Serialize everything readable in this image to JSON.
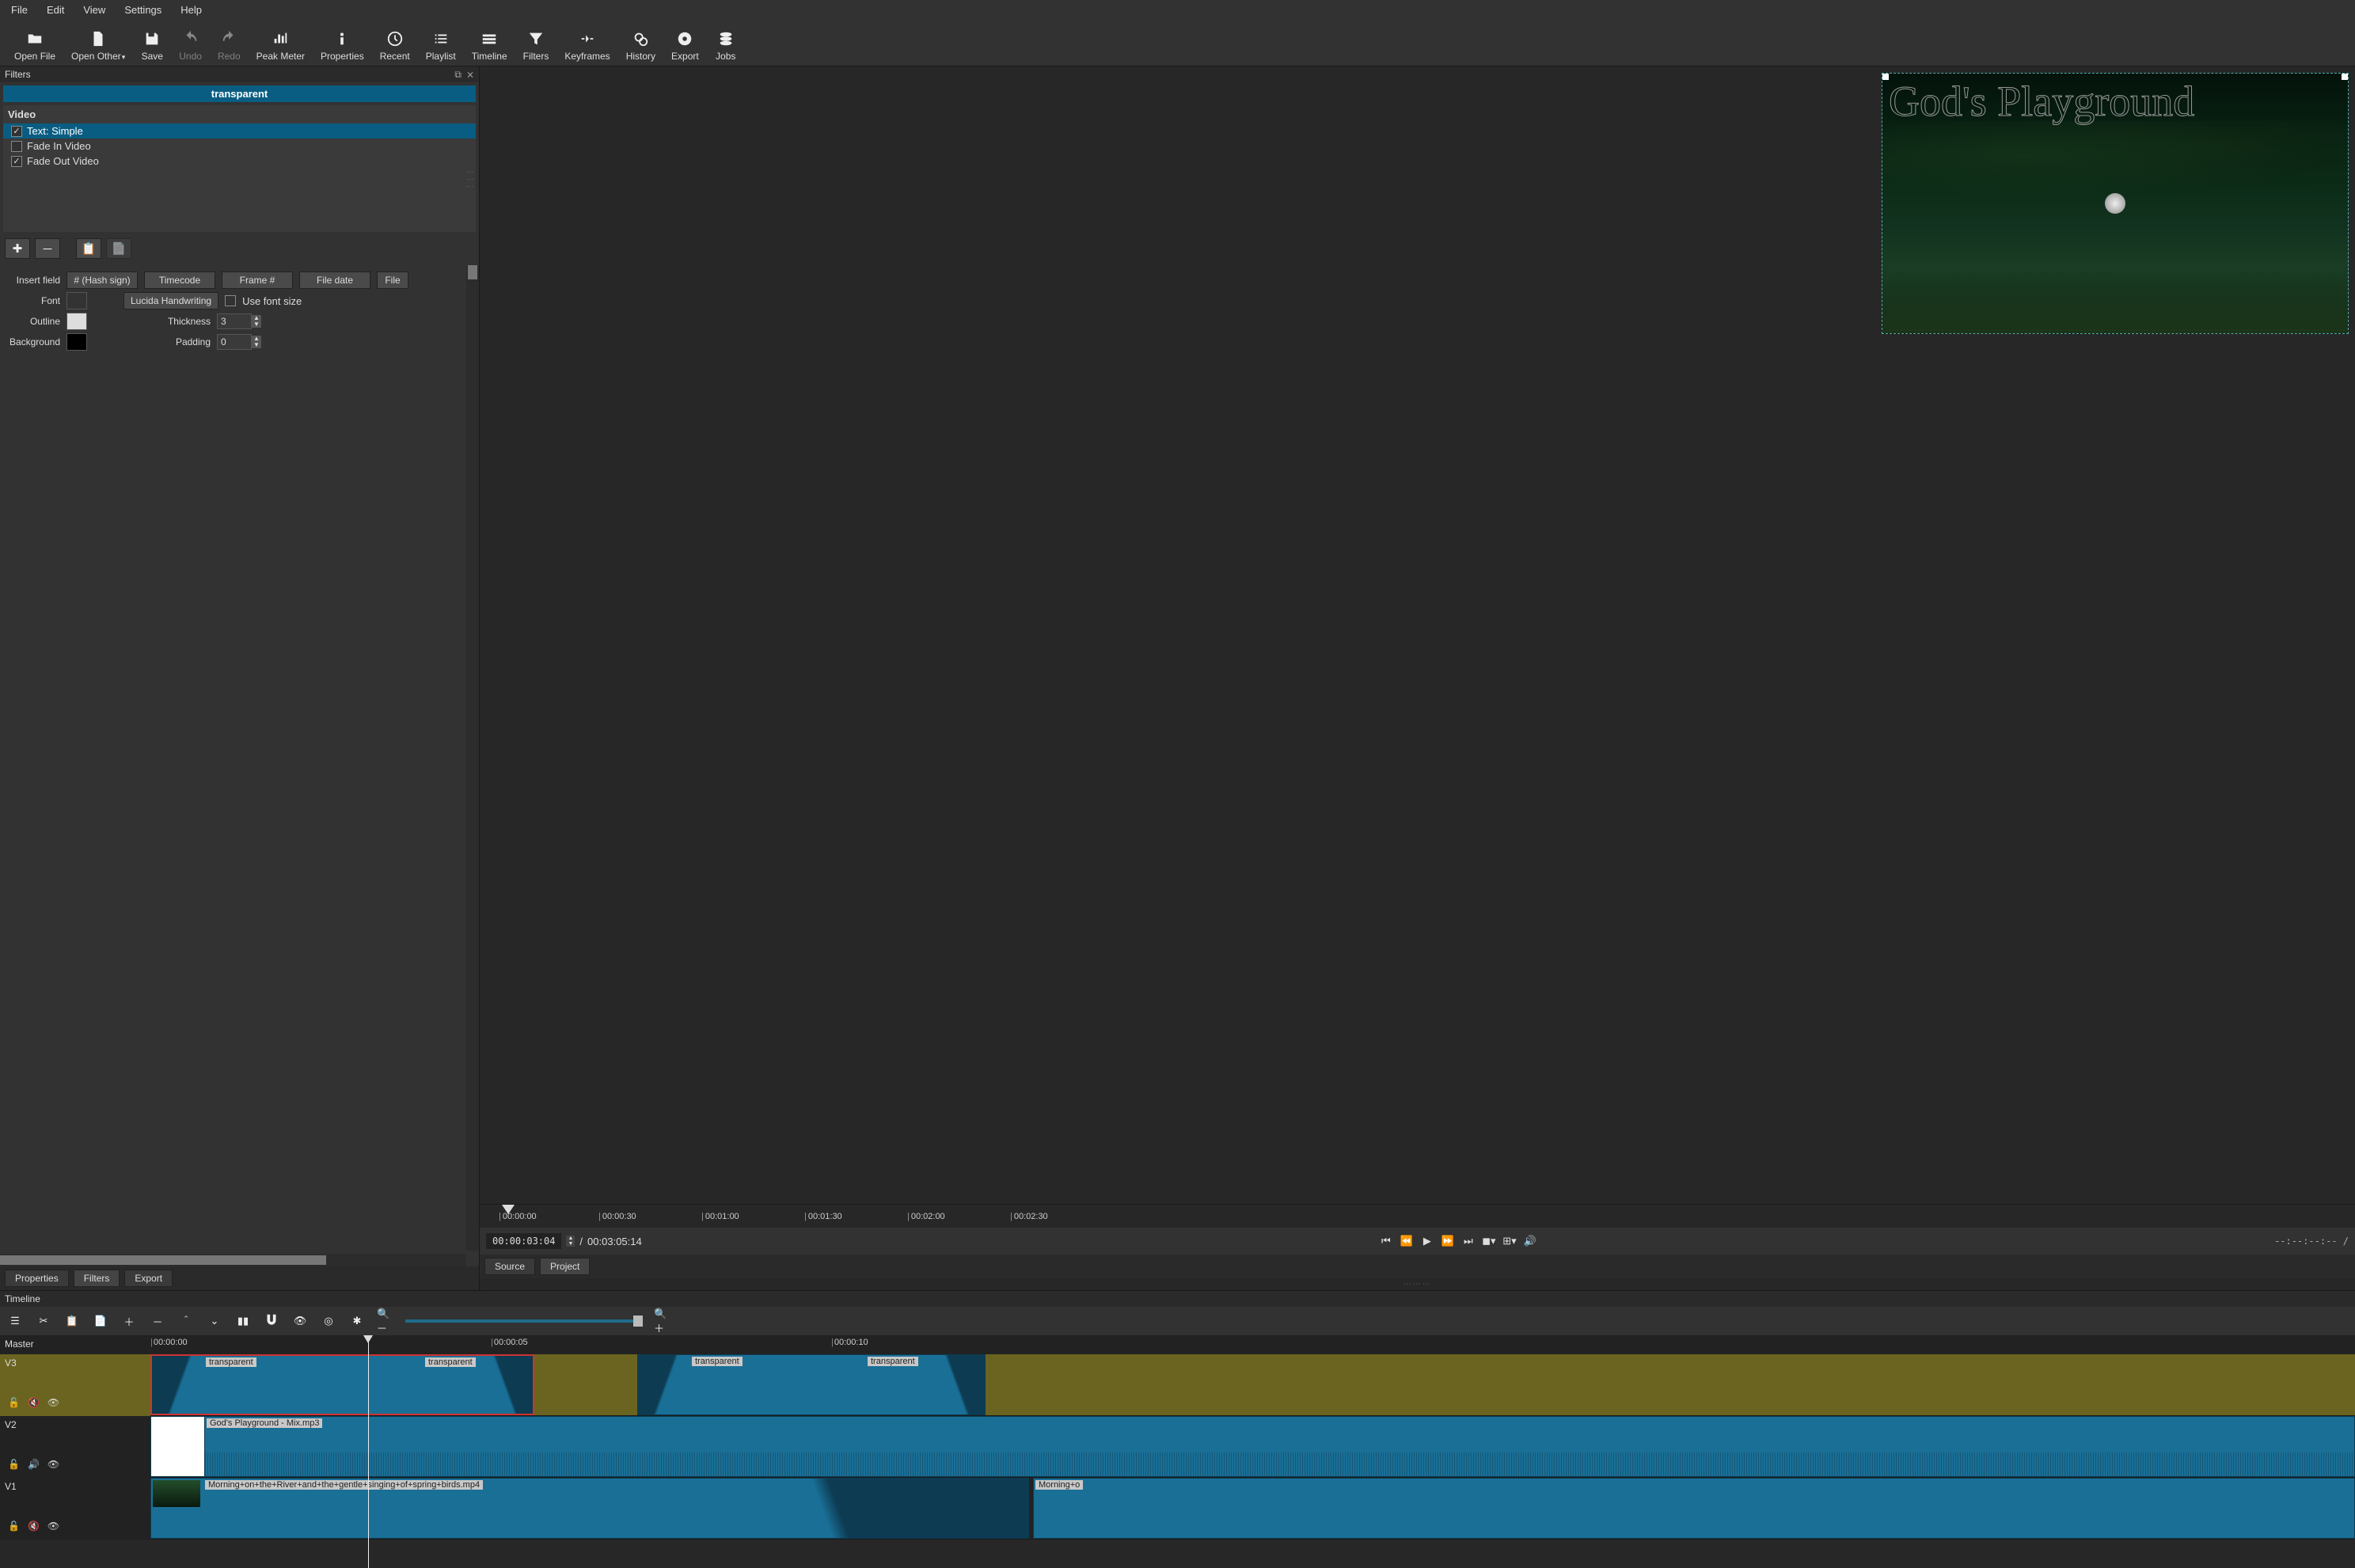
{
  "menubar": [
    "File",
    "Edit",
    "View",
    "Settings",
    "Help"
  ],
  "toolbar": [
    {
      "id": "open-file",
      "label": "Open File",
      "icon": "folder"
    },
    {
      "id": "open-other",
      "label": "Open Other",
      "icon": "file",
      "caret": true
    },
    {
      "id": "save",
      "label": "Save",
      "icon": "save"
    },
    {
      "id": "undo",
      "label": "Undo",
      "icon": "undo",
      "disabled": true
    },
    {
      "id": "redo",
      "label": "Redo",
      "icon": "redo",
      "disabled": true
    },
    {
      "id": "peak-meter",
      "label": "Peak Meter",
      "icon": "meter"
    },
    {
      "id": "properties",
      "label": "Properties",
      "icon": "info"
    },
    {
      "id": "recent",
      "label": "Recent",
      "icon": "clock"
    },
    {
      "id": "playlist",
      "label": "Playlist",
      "icon": "list"
    },
    {
      "id": "timeline",
      "label": "Timeline",
      "icon": "timeline"
    },
    {
      "id": "filters",
      "label": "Filters",
      "icon": "funnel"
    },
    {
      "id": "keyframes",
      "label": "Keyframes",
      "icon": "keyframes"
    },
    {
      "id": "history",
      "label": "History",
      "icon": "history"
    },
    {
      "id": "export",
      "label": "Export",
      "icon": "disc"
    },
    {
      "id": "jobs",
      "label": "Jobs",
      "icon": "stack"
    }
  ],
  "filters_panel": {
    "title": "Filters",
    "clip_name": "transparent",
    "group": "Video",
    "items": [
      {
        "label": "Text: Simple",
        "checked": true,
        "selected": true
      },
      {
        "label": "Fade In Video",
        "checked": false,
        "selected": false
      },
      {
        "label": "Fade Out Video",
        "checked": true,
        "selected": false
      }
    ]
  },
  "text_filter": {
    "insert_field_label": "Insert field",
    "buttons": [
      "# (Hash sign)",
      "Timecode",
      "Frame #",
      "File date",
      "File"
    ],
    "font_label": "Font",
    "font_name": "Lucida Handwriting",
    "use_font_size_label": "Use font size",
    "outline_label": "Outline",
    "thickness_label": "Thickness",
    "thickness_value": "3",
    "background_label": "Background",
    "padding_label": "Padding",
    "padding_value": "0"
  },
  "left_tabs": [
    "Properties",
    "Filters",
    "Export"
  ],
  "left_tabs_active": 1,
  "preview": {
    "overlay_text": "God's Playground",
    "ruler": [
      "00:00:00",
      "00:00:30",
      "00:01:00",
      "00:01:30",
      "00:02:00",
      "00:02:30"
    ],
    "current_tc": "00:00:03:04",
    "total_tc": "00:03:05:14",
    "inout": "--:--:--:-- /"
  },
  "right_tabs": [
    "Source",
    "Project"
  ],
  "right_tabs_active": 1,
  "timeline": {
    "title": "Timeline",
    "master": "Master",
    "ruler": [
      "00:00:00",
      "00:00:05",
      "00:00:10"
    ],
    "track3": {
      "name": "V3",
      "clip1": "transparent",
      "clip2": "transparent",
      "clip3": "transparent",
      "clip4": "transparent"
    },
    "track2": {
      "name": "V2",
      "clip": "God's Playground - Mix.mp3"
    },
    "track1": {
      "name": "V1",
      "clip": "Morning+on+the+River+and+the+gentle+singing+of+spring+birds.mp4",
      "clip2": "Morning+o"
    }
  }
}
